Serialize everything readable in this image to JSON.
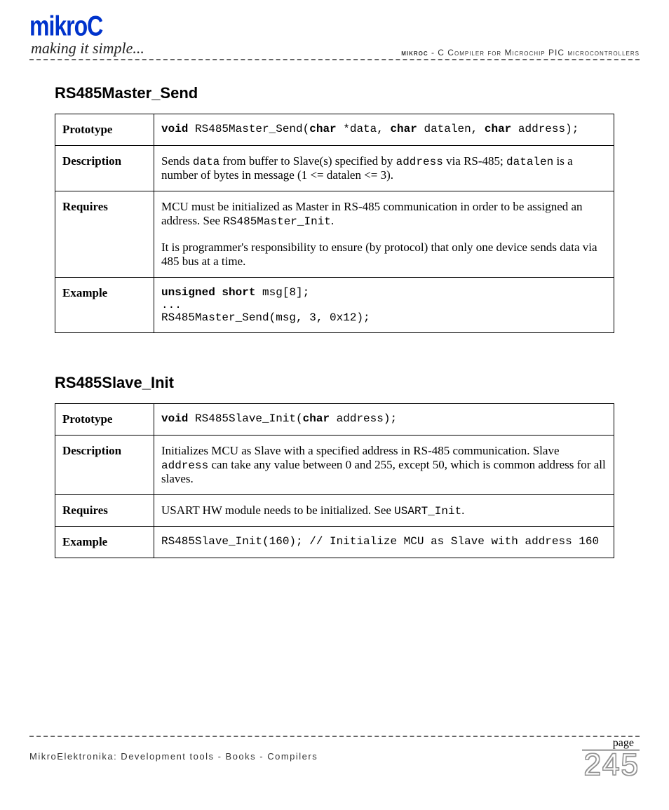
{
  "header": {
    "logo": "mikroC",
    "tagline": "making it simple...",
    "right_prefix": "mikroC",
    "right_text": " - C Compiler for Microchip PIC microcontrollers"
  },
  "sections": [
    {
      "title": "RS485Master_Send",
      "rows": {
        "prototype_label": "Prototype",
        "prototype_html": "<b>void</b> RS485Master_Send(<b>char</b> *data, <b>char</b> datalen, <b>char</b> address);",
        "description_label": "Description",
        "description_html": "Sends <span class=\"mono\">data</span> from buffer to Slave(s) specified by <span class=\"mono\">address</span> via RS-485; <span class=\"mono\">datalen</span> is a number of bytes in message (1 &lt;= datalen &lt;= 3).",
        "requires_label": "Requires",
        "requires_html": "<div class=\"req-block\"><p>MCU must be initialized as Master in RS-485 communication in order to be assigned an address. See <span class=\"mono\">RS485Master_Init</span>.</p><p>It is programmer's responsibility to ensure (by protocol) that only one device sends data via 485 bus at a time.</p></div>",
        "example_label": "Example",
        "example_html": "<b>unsigned</b> <b>short</b> msg[8];<br>...<br>RS485Master_Send(msg, 3, 0x12);"
      }
    },
    {
      "title": "RS485Slave_Init",
      "rows": {
        "prototype_label": "Prototype",
        "prototype_html": "<b>void</b> RS485Slave_Init(<b>char</b> address);",
        "description_label": "Description",
        "description_html": "Initializes MCU as Slave with a specified address in RS-485 communication. Slave <span class=\"mono\">address</span> can take any value between 0 and 255, except 50, which is common address for all slaves.",
        "requires_label": "Requires",
        "requires_html": "USART HW module needs to be initialized. See <span class=\"mono\">USART_Init</span>.",
        "example_label": "Example",
        "example_html": "RS485Slave_Init(160); // Initialize MCU as Slave with address 160"
      }
    }
  ],
  "footer": {
    "text": "MikroElektronika: Development tools - Books - Compilers",
    "page_label": "page",
    "page_number": "245"
  }
}
